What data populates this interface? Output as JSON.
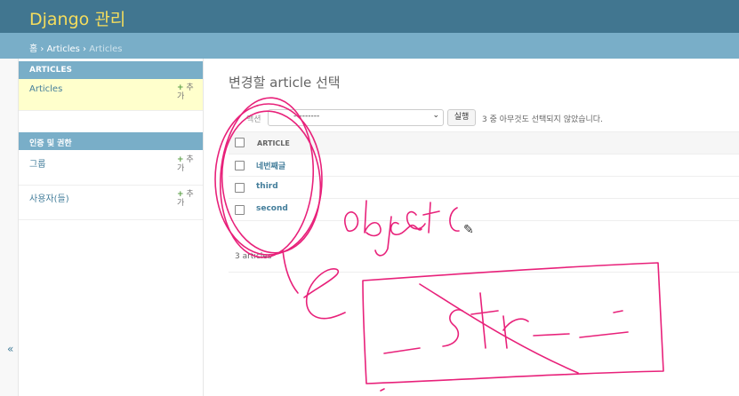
{
  "header": {
    "site_title": "Django 관리"
  },
  "breadcrumb": {
    "home": "홈",
    "sep1": " › ",
    "app": "Articles",
    "sep2": " › ",
    "current": "Articles"
  },
  "sidebar": {
    "toggle": "«",
    "modules": [
      {
        "caption": "ARTICLES",
        "models": [
          {
            "label": "Articles",
            "add": "+",
            "add_label": "추가"
          }
        ]
      },
      {
        "caption": "인증 및 권한",
        "models": [
          {
            "label": "그룹",
            "add": "+",
            "add_label": "추가"
          },
          {
            "label": "사용자(들)",
            "add": "+",
            "add_label": "추가"
          }
        ]
      }
    ]
  },
  "content": {
    "title": "변경할 article 선택",
    "actions": {
      "label": "액션",
      "select_value": "---------",
      "run_label": "실행",
      "selected_count": "3 중 아무것도 선택되지 않았습니다."
    },
    "table": {
      "column_header": "ARTICLE",
      "rows": [
        {
          "title": "네번째글"
        },
        {
          "title": "third"
        },
        {
          "title": "second"
        }
      ]
    },
    "paginator": "3 articles"
  },
  "annotations": {
    "ink_color": "#e8217a",
    "handwriting": [
      "object(",
      "e",
      "_.Str_ _"
    ]
  }
}
